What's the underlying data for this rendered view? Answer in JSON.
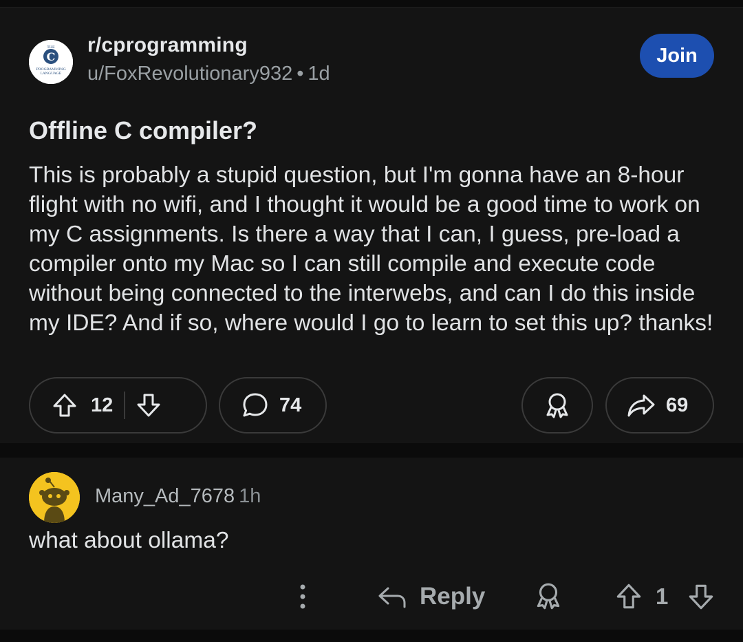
{
  "post": {
    "subreddit": "r/cprogramming",
    "author": "u/FoxRevolutionary932",
    "age": "1d",
    "join_label": "Join",
    "title": "Offline C compiler?",
    "body": "This is probably a stupid question, but I'm gonna have an 8-hour flight with no wifi, and I thought it would be a good time to work on my C assignments. Is there a way that I can, I guess, pre-load a compiler onto my Mac so I can still compile and execute code without being connected to the interwebs, and can I do this inside my IDE? And if so, where would I go to learn to set this up? thanks!",
    "score": "12",
    "comments": "74",
    "shares": "69",
    "logo": {
      "top_text": "THE",
      "letter": "C",
      "bottom_text_1": "PROGRAMMING",
      "bottom_text_2": "LANGUAGE"
    }
  },
  "comment": {
    "author": "Many_Ad_7678",
    "age": "1h",
    "text": "what about ollama?",
    "reply_label": "Reply",
    "score": "1"
  },
  "icons": {
    "upvote": "upvote-arrow-icon",
    "downvote": "downvote-arrow-icon",
    "comment": "speech-bubble-icon",
    "award": "award-ribbon-icon",
    "share": "share-arrow-icon",
    "reply": "reply-arrow-icon",
    "more": "vertical-dots-icon",
    "avatar": "snoo-avatar-icon"
  },
  "colors": {
    "background": "#141414",
    "join_button": "#1d4fb0",
    "avatar_bg": "#f4c31f",
    "text_primary": "#e1e3e5",
    "text_muted": "#9aa0a4"
  }
}
